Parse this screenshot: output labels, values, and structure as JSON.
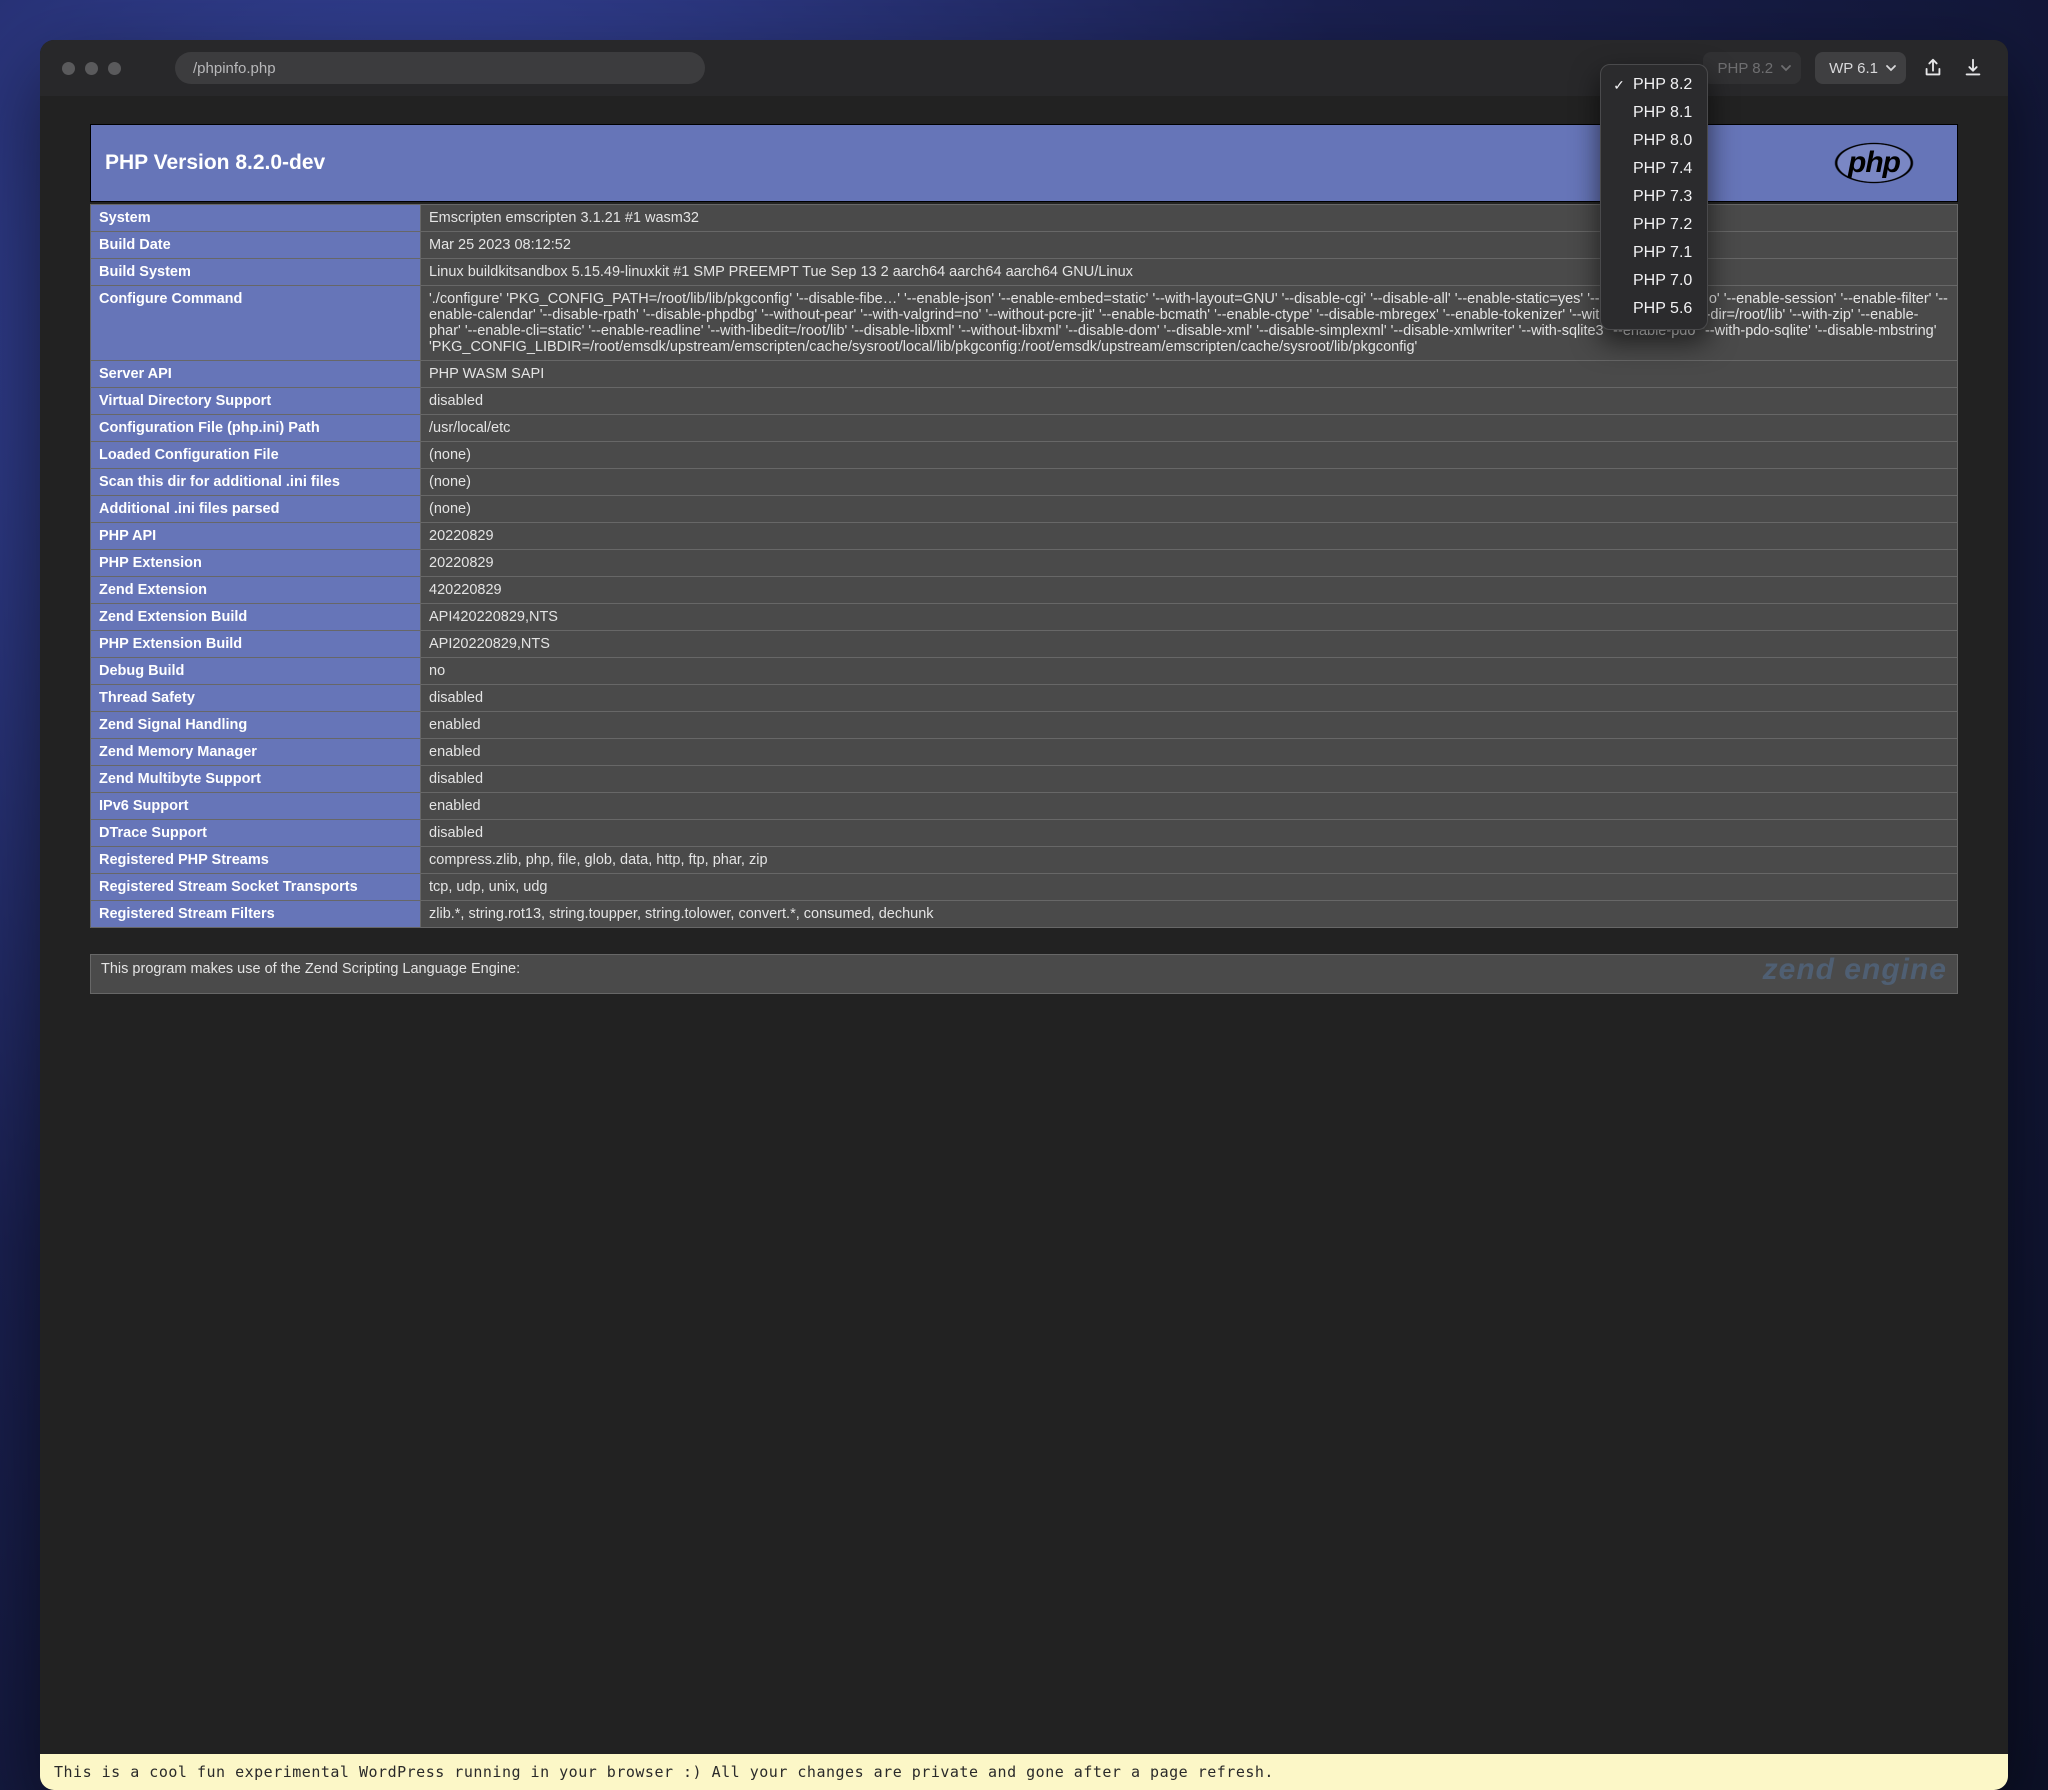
{
  "toolbar": {
    "url": "/phpinfo.php",
    "php_dropdown_label": "PHP 8.2",
    "wp_dropdown_label": "WP 6.1"
  },
  "php_menu": {
    "selected_index": 0,
    "items": [
      {
        "label": "PHP 8.2"
      },
      {
        "label": "PHP 8.1"
      },
      {
        "label": "PHP 8.0"
      },
      {
        "label": "PHP 7.4"
      },
      {
        "label": "PHP 7.3"
      },
      {
        "label": "PHP 7.2"
      },
      {
        "label": "PHP 7.1"
      },
      {
        "label": "PHP 7.0"
      },
      {
        "label": "PHP 5.6"
      }
    ]
  },
  "phpinfo": {
    "title": "PHP Version 8.2.0-dev",
    "logo_text": "php",
    "rows": [
      {
        "k": "System",
        "v": "Emscripten emscripten 3.1.21 #1 wasm32"
      },
      {
        "k": "Build Date",
        "v": "Mar 25 2023 08:12:52"
      },
      {
        "k": "Build System",
        "v": "Linux buildkitsandbox 5.15.49-linuxkit #1 SMP PREEMPT Tue Sep 13              2 aarch64 aarch64 aarch64 GNU/Linux"
      },
      {
        "k": "Configure Command",
        "v": "'./configure' 'PKG_CONFIG_PATH=/root/lib/lib/pkgconfig' '--disable-fibe…' '--enable-json' '--enable-embed=static' '--with-layout=GNU' '--disable-cgi' '--disable-all' '--enable-static=yes' '--enable-shared=no' '--enable-session' '--enable-filter' '--enable-calendar' '--disable-rpath' '--disable-phpdbg' '--without-pear' '--with-valgrind=no' '--without-pcre-jit' '--enable-bcmath' '--enable-ctype' '--disable-mbregex' '--enable-tokenizer' '--with-zlib' '--with-zlib-dir=/root/lib' '--with-zip' '--enable-phar' '--enable-cli=static' '--enable-readline' '--with-libedit=/root/lib' '--disable-libxml' '--without-libxml' '--disable-dom' '--disable-xml' '--disable-simplexml' '--disable-xmlwriter' '--with-sqlite3' '--enable-pdo' '--with-pdo-sqlite' '--disable-mbstring' 'PKG_CONFIG_LIBDIR=/root/emsdk/upstream/emscripten/cache/sysroot/local/lib/pkgconfig:/root/emsdk/upstream/emscripten/cache/sysroot/lib/pkgconfig'"
      },
      {
        "k": "Server API",
        "v": "PHP WASM SAPI"
      },
      {
        "k": "Virtual Directory Support",
        "v": "disabled"
      },
      {
        "k": "Configuration File (php.ini) Path",
        "v": "/usr/local/etc"
      },
      {
        "k": "Loaded Configuration File",
        "v": "(none)"
      },
      {
        "k": "Scan this dir for additional .ini files",
        "v": "(none)"
      },
      {
        "k": "Additional .ini files parsed",
        "v": "(none)"
      },
      {
        "k": "PHP API",
        "v": "20220829"
      },
      {
        "k": "PHP Extension",
        "v": "20220829"
      },
      {
        "k": "Zend Extension",
        "v": "420220829"
      },
      {
        "k": "Zend Extension Build",
        "v": "API420220829,NTS"
      },
      {
        "k": "PHP Extension Build",
        "v": "API20220829,NTS"
      },
      {
        "k": "Debug Build",
        "v": "no"
      },
      {
        "k": "Thread Safety",
        "v": "disabled"
      },
      {
        "k": "Zend Signal Handling",
        "v": "enabled"
      },
      {
        "k": "Zend Memory Manager",
        "v": "enabled"
      },
      {
        "k": "Zend Multibyte Support",
        "v": "disabled"
      },
      {
        "k": "IPv6 Support",
        "v": "enabled"
      },
      {
        "k": "DTrace Support",
        "v": "disabled"
      },
      {
        "k": "Registered PHP Streams",
        "v": "compress.zlib, php, file, glob, data, http, ftp, phar, zip"
      },
      {
        "k": "Registered Stream Socket Transports",
        "v": "tcp, udp, unix, udg"
      },
      {
        "k": "Registered Stream Filters",
        "v": "zlib.*, string.rot13, string.toupper, string.tolower, convert.*, consumed, dechunk"
      }
    ],
    "zend_text": "This program makes use of the Zend Scripting Language Engine:",
    "zend_logo": "zend engine"
  },
  "banner": "This is a cool fun experimental WordPress running in your browser :) All your changes are private and gone after a page refresh."
}
